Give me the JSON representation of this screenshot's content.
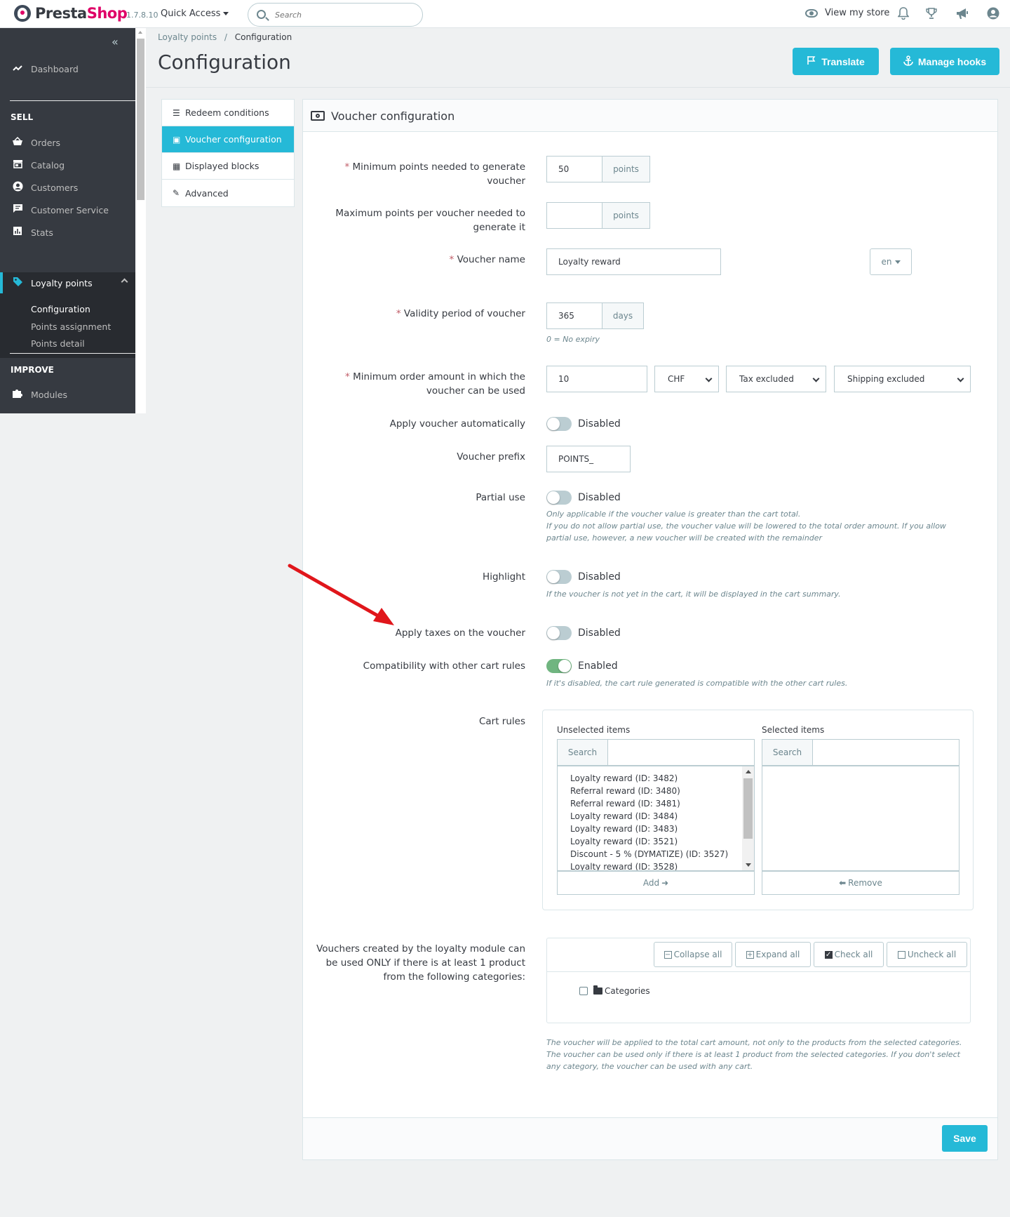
{
  "header": {
    "logo_prefix": "Presta",
    "logo_suffix": "Shop",
    "version": "1.7.8.10",
    "quick_access": "Quick Access",
    "search_placeholder": "Search",
    "view_store": "View my store"
  },
  "sidebar": {
    "dashboard": "Dashboard",
    "sell_heading": "SELL",
    "items": [
      "Orders",
      "Catalog",
      "Customers",
      "Customer Service",
      "Stats",
      "Loyalty points"
    ],
    "subitems": [
      "Configuration",
      "Points assignment",
      "Points detail"
    ],
    "improve_heading": "IMPROVE",
    "modules": "Modules"
  },
  "breadcrumb": {
    "parent": "Loyalty points",
    "separator": "/",
    "current": "Configuration"
  },
  "page": {
    "title": "Configuration",
    "translate_label": "Translate",
    "manage_hooks_label": "Manage hooks"
  },
  "tabs": [
    "Redeem conditions",
    "Voucher configuration",
    "Displayed blocks",
    "Advanced"
  ],
  "panel": {
    "title": "Voucher configuration",
    "save_label": "Save"
  },
  "form": {
    "required_mark": "*",
    "min_points": {
      "label": "Minimum points needed to generate voucher",
      "value": "50",
      "addon": "points"
    },
    "max_points": {
      "label": "Maximum points per voucher needed to generate it",
      "value": "",
      "addon": "points"
    },
    "voucher_name": {
      "label": "Voucher name",
      "value": "Loyalty reward",
      "lang": "en"
    },
    "validity": {
      "label": "Validity period of voucher",
      "value": "365",
      "addon": "days",
      "help": "0 = No expiry"
    },
    "min_order": {
      "label": "Minimum order amount in which the voucher can be used",
      "value": "10",
      "currency": "CHF",
      "tax": "Tax excluded",
      "shipping": "Shipping excluded"
    },
    "apply_auto": {
      "label": "Apply voucher automatically",
      "state": "Disabled"
    },
    "prefix": {
      "label": "Voucher prefix",
      "value": "POINTS_"
    },
    "partial_use": {
      "label": "Partial use",
      "state": "Disabled",
      "help1": "Only applicable if the voucher value is greater than the cart total.",
      "help2": "If you do not allow partial use, the voucher value will be lowered to the total order amount. If you allow partial use, however, a new voucher will be created with the remainder"
    },
    "highlight": {
      "label": "Highlight",
      "state": "Disabled",
      "help": "If the voucher is not yet in the cart, it will be displayed in the cart summary."
    },
    "apply_taxes": {
      "label": "Apply taxes on the voucher",
      "state": "Disabled"
    },
    "compat": {
      "label": "Compatibility with other cart rules",
      "state": "Enabled",
      "help": "If it's disabled, the cart rule generated is compatible with the other cart rules."
    },
    "cart_rules": {
      "label": "Cart rules",
      "unselected_label": "Unselected items",
      "selected_label": "Selected items",
      "search_label": "Search",
      "items": [
        "Loyalty reward (ID: 3482)",
        "Referral reward (ID: 3480)",
        "Referral reward (ID: 3481)",
        "Loyalty reward (ID: 3484)",
        "Loyalty reward (ID: 3483)",
        "Loyalty reward (ID: 3521)",
        "Discount - 5 % (DYMATIZE) (ID: 3527)",
        "Loyalty reward (ID: 3528)"
      ],
      "add_label": "Add",
      "remove_label": "Remove"
    },
    "categories": {
      "label": "Vouchers created by the loyalty module can be used ONLY if there is at least 1 product from the following categories:",
      "collapse_all": "Collapse all",
      "expand_all": "Expand all",
      "check_all": "Check all",
      "uncheck_all": "Uncheck all",
      "root": "Categories",
      "help1": "The voucher will be applied to the total cart amount, not only to the products from the selected categories.",
      "help2": "The voucher can be used only if there is at least 1 product from the selected categories. If you don't select any category, the voucher can be used with any cart."
    }
  },
  "colors": {
    "primary": "#25b9d7",
    "sidebar": "#363a41",
    "enabled": "#70b580",
    "required": "#c05c67",
    "arrow": "#e0161b"
  }
}
